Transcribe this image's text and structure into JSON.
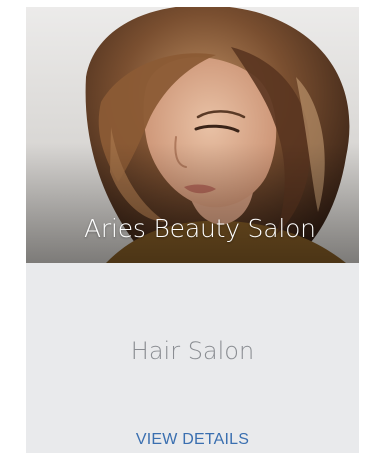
{
  "card": {
    "title": "Aries Beauty Salon",
    "category": "Hair Salon",
    "action_label": "VIEW DETAILS"
  },
  "colors": {
    "card_background": "#e9eaec",
    "title_text": "#ffffff",
    "category_text": "#8a8d92",
    "action_link": "#3a6fb0"
  }
}
